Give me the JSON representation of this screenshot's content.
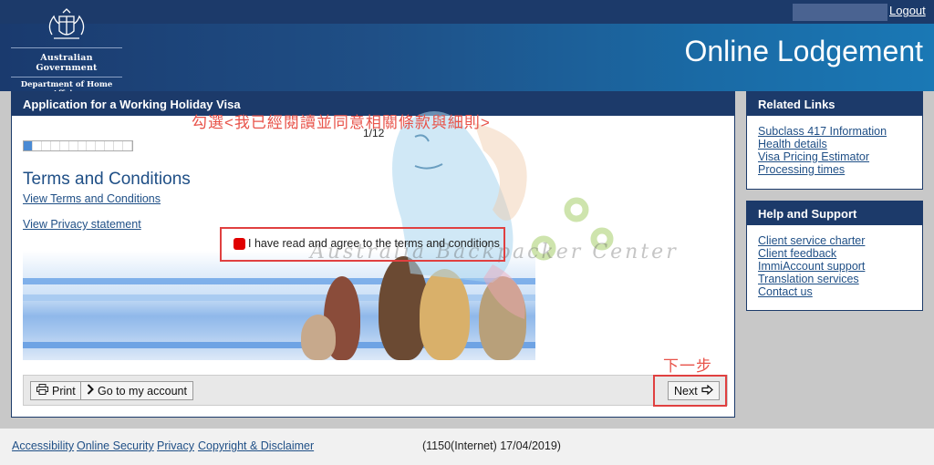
{
  "header": {
    "gov_name": "Australian Government",
    "dept_name": "Department of Home Affairs",
    "logout": "Logout",
    "page_title": "Online Lodgement"
  },
  "main": {
    "title": "Application for a Working Holiday Visa",
    "step": "1/12",
    "progress": {
      "current": 1,
      "total": 12
    },
    "heading": "Terms and Conditions",
    "link_terms": "View Terms and Conditions",
    "link_privacy": "View Privacy statement",
    "agree_label": "I have read and agree to the terms and conditions",
    "agree_checked": true,
    "annotation_cn": "勾選<我已經閱讀並同意相關條款與細則>",
    "annotation_next": "下一步",
    "watermark": "Australia Backpacker Center"
  },
  "buttons": {
    "print": "Print",
    "account": "Go to my account",
    "next": "Next"
  },
  "related_links": {
    "title": "Related Links",
    "items": [
      "Subclass 417 Information",
      "Health details",
      "Visa Pricing Estimator",
      "Processing times"
    ]
  },
  "help_support": {
    "title": "Help and Support",
    "items": [
      "Client service charter",
      "Client feedback",
      "ImmiAccount support",
      "Translation services",
      "Contact us"
    ]
  },
  "footer": {
    "links": [
      "Accessibility",
      "Online Security",
      "Privacy",
      "Copyright & Disclaimer"
    ],
    "version": "(1150(Internet) 17/04/2019)"
  },
  "colors": {
    "navy": "#1c3a6a",
    "link": "#1f4f86",
    "annotation_red": "#e04040"
  }
}
